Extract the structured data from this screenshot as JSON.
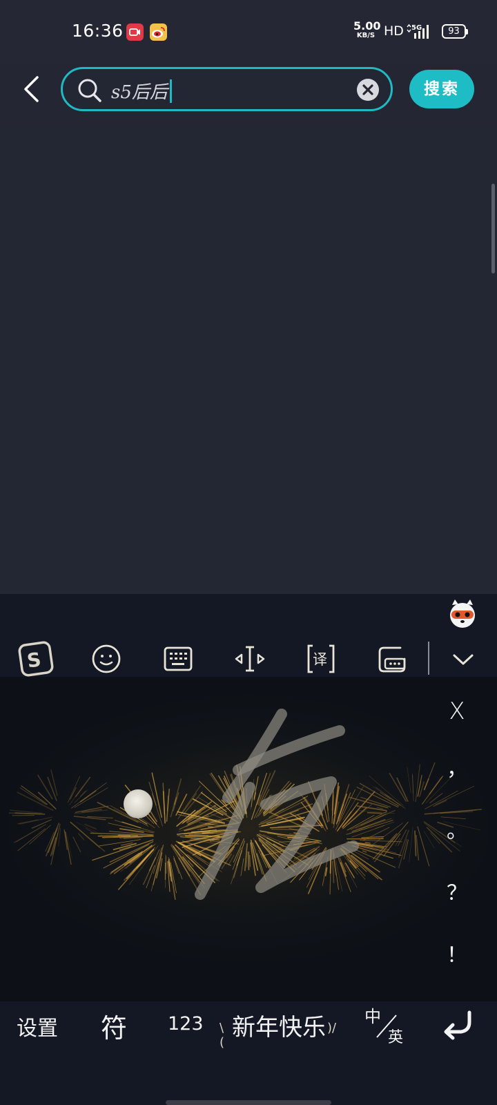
{
  "status_bar": {
    "time": "16:36",
    "net_speed_value": "5.00",
    "net_speed_unit": "KB/S",
    "hd": "HD",
    "network": "5G",
    "battery": "93"
  },
  "search": {
    "query": "s5后后",
    "button_label": "搜索"
  },
  "keyboard": {
    "punctuation": [
      "X",
      "，",
      "。",
      "？",
      "！"
    ],
    "settings_label": "设置",
    "symbols_label": "符",
    "numbers_label": "123",
    "phrase_label": "新年快乐",
    "lang_cn": "中",
    "lang_en": "英",
    "handwriting_preview": "后"
  },
  "colors": {
    "accent": "#1ebdc5",
    "background": "#242733",
    "keyboard_bg": "#131824"
  }
}
